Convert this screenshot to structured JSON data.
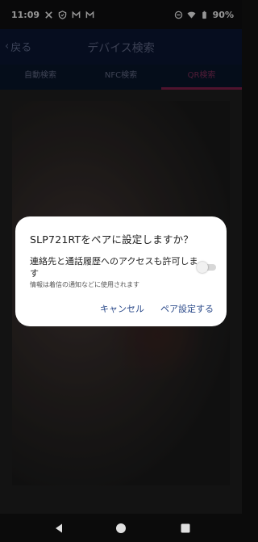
{
  "status_bar": {
    "time": "11:09",
    "left_icons": [
      "x-icon",
      "shield-icon",
      "gmail-icon",
      "gmail-icon"
    ],
    "right_icons": [
      "dnd-icon",
      "wifi-icon",
      "battery-icon"
    ],
    "battery": "90%"
  },
  "app_bar": {
    "back_label": "戻る",
    "title": "デバイス検索"
  },
  "tabs": [
    {
      "label": "自動検索",
      "active": false
    },
    {
      "label": "NFC検索",
      "active": false
    },
    {
      "label": "QR検索",
      "active": true
    }
  ],
  "dialog": {
    "title": "SLP721RTをペアに設定しますか？",
    "permission_text": "連絡先と通話履歴へのアクセスも許可します",
    "permission_subtext": "情報は着信の通知などに使用されます",
    "toggle_on": false,
    "cancel_label": "キャンセル",
    "pair_label": "ペア設定する"
  },
  "colors": {
    "accent": "#2b4a8a",
    "active_tab": "#7a1e48"
  }
}
